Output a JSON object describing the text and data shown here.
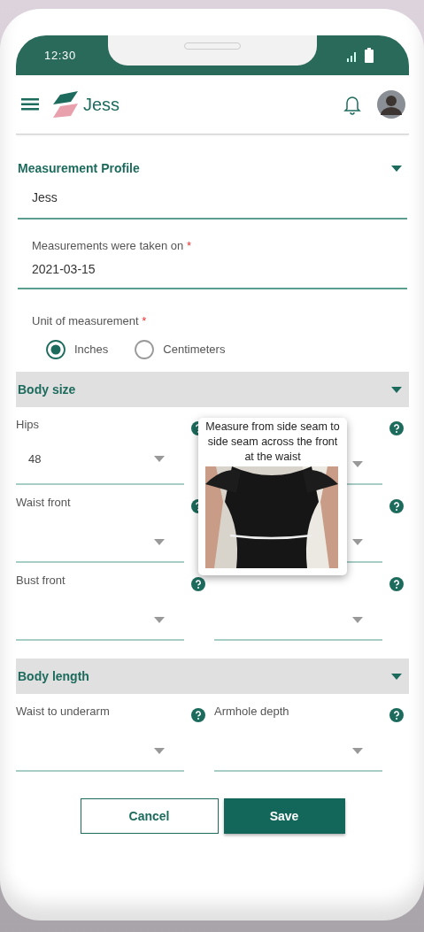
{
  "status_bar": {
    "time": "12:30"
  },
  "header": {
    "title": "Jess"
  },
  "profile": {
    "title": "Measurement Profile",
    "expanded": true,
    "name_value": "Jess",
    "date": {
      "label": "Measurements were taken on",
      "required_mark": "*",
      "value": "2021-03-15"
    },
    "unit": {
      "label": "Unit of measurement",
      "required_mark": "*",
      "options": [
        {
          "label": "Inches",
          "selected": true
        },
        {
          "label": "Centimeters",
          "selected": false
        }
      ]
    }
  },
  "sections": [
    {
      "title": "Body size",
      "expanded": true,
      "fields": [
        {
          "label": "Hips",
          "value": "48",
          "help": true
        },
        {
          "help": true
        },
        {
          "label": "Waist front",
          "help": true
        },
        {
          "help": true
        },
        {
          "label": "Bust front",
          "help": true
        },
        {
          "help": true
        }
      ],
      "tooltip": {
        "text": "Measure from side seam to side seam across the front at the waist",
        "kind": "picture"
      }
    },
    {
      "title": "Body length",
      "expanded": true,
      "fields": [
        {
          "label": "Waist to underarm",
          "help": true
        },
        {
          "label": "Armhole depth",
          "help": true
        }
      ]
    }
  ],
  "buttons": [
    {
      "label": "Cancel",
      "kind": "secondary"
    },
    {
      "label": "Save",
      "kind": "primary"
    }
  ]
}
